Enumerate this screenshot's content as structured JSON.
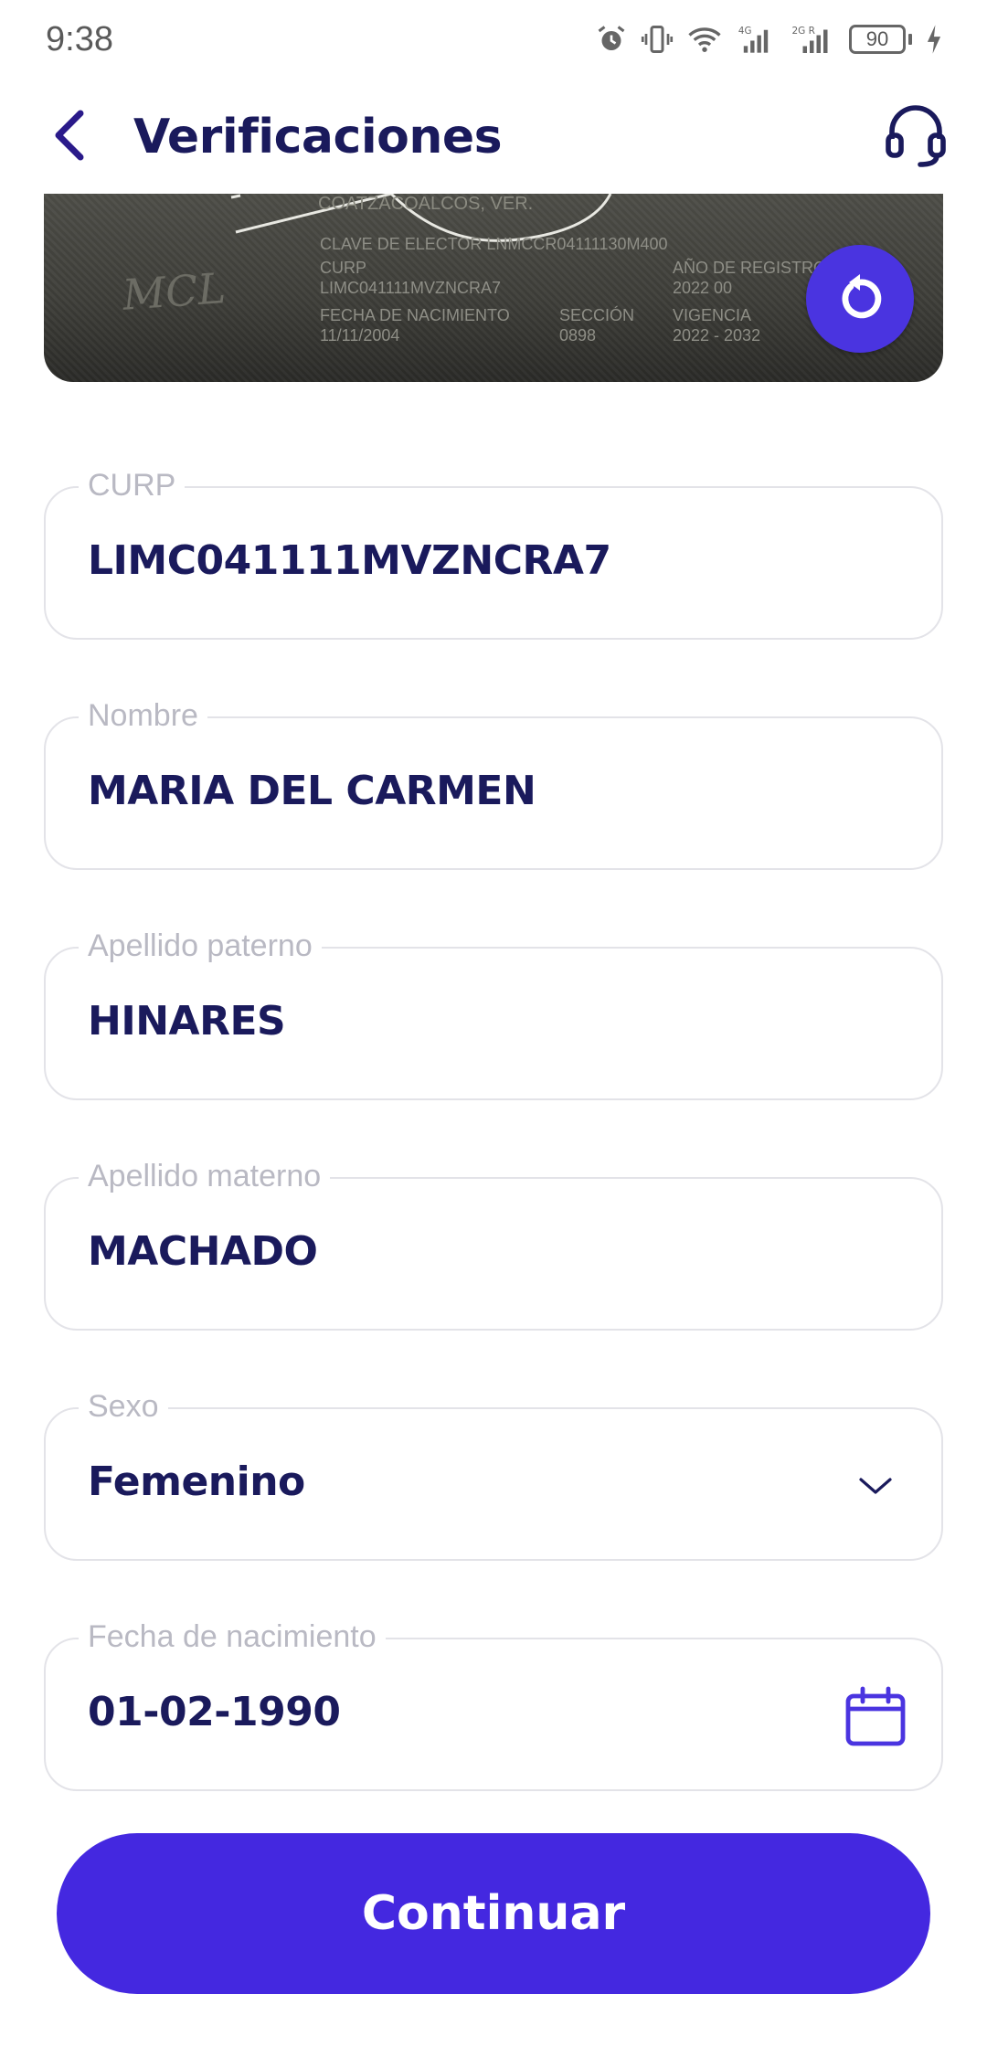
{
  "status_bar": {
    "time": "9:38",
    "battery": "90",
    "icons": [
      "alarm-icon",
      "vibrate-icon",
      "wifi-icon",
      "signal-4g-icon",
      "signal-2g-icon",
      "battery-icon",
      "charging-icon"
    ]
  },
  "header": {
    "title": "Verificaciones",
    "back_icon": "chevron-left-icon",
    "support_icon": "headset-icon"
  },
  "id_card": {
    "lines": [
      "COATZACOALCOS, VER.",
      "CLAVE DE ELECTOR  LNMCCR04111130M400",
      "CURP",
      "LIMC041111MVZNCRA7",
      "FECHA DE NACIMIENTO",
      "11/11/2004",
      "SECCIÓN",
      "0898",
      "AÑO DE REGISTRO",
      "2022 00",
      "VIGENCIA",
      "2022 - 2032"
    ],
    "refresh_icon": "refresh-icon"
  },
  "form": {
    "curp": {
      "label": "CURP",
      "value": "LIMC041111MVZNCRA7"
    },
    "nombre": {
      "label": "Nombre",
      "value": "MARIA DEL CARMEN"
    },
    "apellido_paterno": {
      "label": "Apellido paterno",
      "value": "HINARES"
    },
    "apellido_materno": {
      "label": "Apellido materno",
      "value": "MACHADO"
    },
    "sexo": {
      "label": "Sexo",
      "value": "Femenino",
      "icon": "chevron-down-icon"
    },
    "fecha_nacimiento": {
      "label": "Fecha de nacimiento",
      "value": "01-02-1990",
      "icon": "calendar-icon"
    }
  },
  "continue_label": "Continuar",
  "colors": {
    "primary": "#4428e0",
    "text_dark": "#1a1a5c",
    "label_gray": "#b9b9c3",
    "border": "#e3e3e8"
  }
}
